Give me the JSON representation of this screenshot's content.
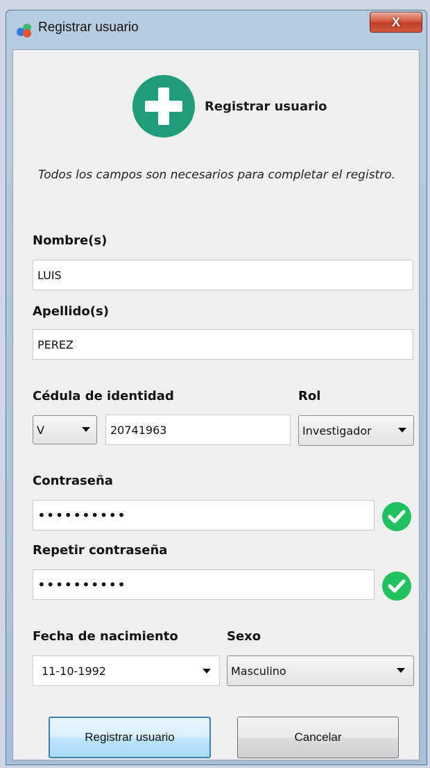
{
  "window": {
    "title": "Registrar usuario",
    "close_label": "X"
  },
  "header": {
    "title": "Registrar usuario",
    "subtitle": "Todos los campos son necesarios para completar el registro."
  },
  "form": {
    "nombre_label": "Nombre(s)",
    "nombre_value": "LUIS",
    "apellido_label": "Apellido(s)",
    "apellido_value": "PEREZ",
    "cedula_label": "Cédula de identidad",
    "cedula_prefix": "V",
    "cedula_value": "20741963",
    "rol_label": "Rol",
    "rol_value": "Investigador",
    "password_label": "Contraseña",
    "password_mask": "••••••••••",
    "repeat_password_label": "Repetir contraseña",
    "repeat_password_mask": "••••••••••",
    "fecha_label": "Fecha de nacimiento",
    "fecha_value": "11-10-1992",
    "sexo_label": "Sexo",
    "sexo_value": "Masculino"
  },
  "buttons": {
    "submit_label": "Registrar usuario",
    "cancel_label": "Cancelar"
  },
  "colors": {
    "accent_green": "#1f9c79",
    "check_green": "#21c15d",
    "primary_button_border": "#3c7fb1"
  }
}
